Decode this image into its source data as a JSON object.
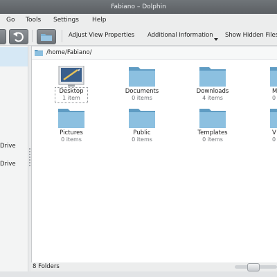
{
  "window": {
    "title": "Fabiano – Dolphin"
  },
  "menubar": {
    "items": [
      {
        "label": "Go"
      },
      {
        "label": "Tools"
      },
      {
        "label": "Settings"
      },
      {
        "label": "Help"
      }
    ]
  },
  "toolbar": {
    "adjust_view_label": "Adjust View Properties",
    "additional_info_label": "Additional Information",
    "show_hidden_label": "Show Hidden Files"
  },
  "sidebar": {
    "items": [
      {
        "label": "Drive"
      },
      {
        "label": "Drive"
      }
    ]
  },
  "location": {
    "path": "/home/Fabiano/"
  },
  "files": [
    {
      "name": "Desktop",
      "count": "1 item",
      "icon": "desktop-folder-icon"
    },
    {
      "name": "Documents",
      "count": "0 items",
      "icon": "folder-icon"
    },
    {
      "name": "Downloads",
      "count": "4 items",
      "icon": "folder-icon"
    },
    {
      "name": "M",
      "count": "0",
      "icon": "folder-icon"
    },
    {
      "name": "Pictures",
      "count": "0 items",
      "icon": "folder-icon"
    },
    {
      "name": "Public",
      "count": "0 items",
      "icon": "folder-icon"
    },
    {
      "name": "Templates",
      "count": "0 items",
      "icon": "folder-icon"
    },
    {
      "name": "V",
      "count": "0",
      "icon": "folder-icon"
    }
  ],
  "statusbar": {
    "text": "8 Folders"
  },
  "colors": {
    "folder_body": "#7fb3d5",
    "folder_tab": "#5f9cc3",
    "selection": "#d6e8f5",
    "titlebar": "#5b5f63"
  }
}
